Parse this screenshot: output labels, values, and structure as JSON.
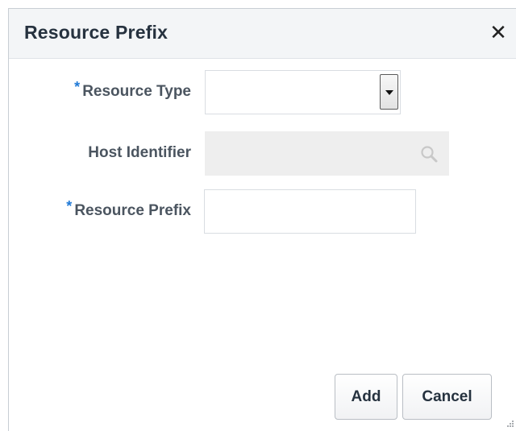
{
  "dialog": {
    "title": "Resource Prefix",
    "close_icon": "close-icon"
  },
  "form": {
    "required_marker": "*",
    "resource_type": {
      "label": "Resource Type",
      "required": true,
      "value": ""
    },
    "host_identifier": {
      "label": "Host Identifier",
      "required": false,
      "value": "",
      "icon": "search-icon",
      "disabled": true
    },
    "resource_prefix": {
      "label": "Resource Prefix",
      "required": true,
      "value": "",
      "placeholder": ""
    }
  },
  "buttons": {
    "add_label": "Add",
    "cancel_label": "Cancel"
  },
  "colors": {
    "required_marker": "#1f79d6",
    "title_bar_bg": "#f3f5f7",
    "disabled_field_bg": "#eeeeee"
  }
}
